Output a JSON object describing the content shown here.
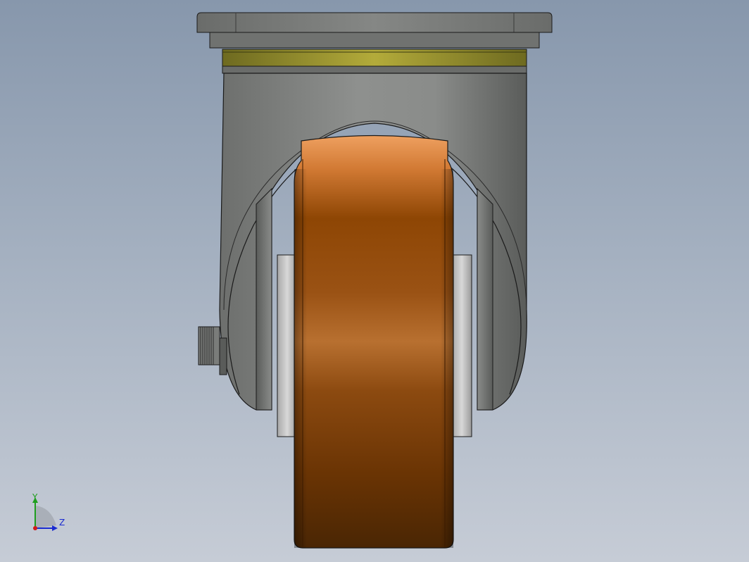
{
  "viewport": {
    "background_top": "#8797ac",
    "background_bottom": "#c6ccd6"
  },
  "model": {
    "component": "swivel-caster-wheel",
    "colors": {
      "housing": "#8a8c8a",
      "housing_dark": "#5f615f",
      "bearing_ring": "#a8a030",
      "wheel_light": "#e8944a",
      "wheel_dark": "#4a2604",
      "hub": "#c8c8c8",
      "outline": "#1a1a1a"
    }
  },
  "triad": {
    "y_label": "Y",
    "z_label": "Z",
    "y_color": "#1e9e1e",
    "z_color": "#1a2ad0",
    "x_color": "#d01a1a"
  }
}
